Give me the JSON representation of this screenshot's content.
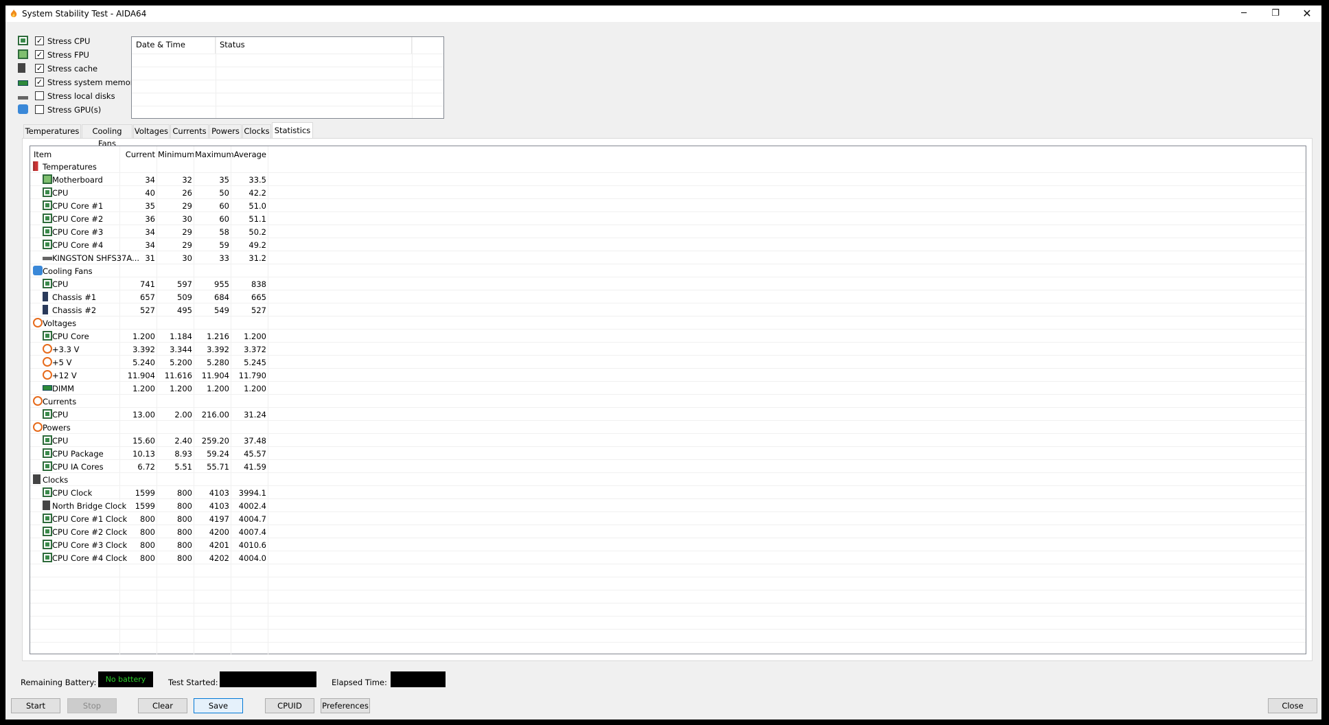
{
  "window": {
    "title": "System Stability Test - AIDA64"
  },
  "stress_options": [
    {
      "label": "Stress CPU",
      "checked": "✓",
      "icon": "cpu-icon"
    },
    {
      "label": "Stress FPU",
      "checked": "✓",
      "icon": "fpu-icon"
    },
    {
      "label": "Stress cache",
      "checked": "✓",
      "icon": "cache-icon"
    },
    {
      "label": "Stress system memory",
      "checked": "✓",
      "icon": "memory-icon"
    },
    {
      "label": "Stress local disks",
      "checked": "",
      "icon": "disk-icon"
    },
    {
      "label": "Stress GPU(s)",
      "checked": "",
      "icon": "gpu-icon"
    }
  ],
  "log": {
    "col_datetime": "Date & Time",
    "col_status": "Status"
  },
  "tabs": [
    "Temperatures",
    "Cooling Fans",
    "Voltages",
    "Currents",
    "Powers",
    "Clocks",
    "Statistics"
  ],
  "active_tab": "Statistics",
  "table": {
    "headers": {
      "item": "Item",
      "current": "Current",
      "minimum": "Minimum",
      "maximum": "Maximum",
      "average": "Average"
    },
    "rows": [
      {
        "name": "Temperatures",
        "group": true,
        "icon": "therm",
        "cur": "",
        "min": "",
        "max": "",
        "avg": ""
      },
      {
        "name": "Motherboard",
        "icon": "board",
        "cur": "34",
        "min": "32",
        "max": "35",
        "avg": "33.5"
      },
      {
        "name": "CPU",
        "icon": "chip",
        "cur": "40",
        "min": "26",
        "max": "50",
        "avg": "42.2"
      },
      {
        "name": "CPU Core #1",
        "icon": "chip",
        "cur": "35",
        "min": "29",
        "max": "60",
        "avg": "51.0"
      },
      {
        "name": "CPU Core #2",
        "icon": "chip",
        "cur": "36",
        "min": "30",
        "max": "60",
        "avg": "51.1"
      },
      {
        "name": "CPU Core #3",
        "icon": "chip",
        "cur": "34",
        "min": "29",
        "max": "58",
        "avg": "50.2"
      },
      {
        "name": "CPU Core #4",
        "icon": "chip",
        "cur": "34",
        "min": "29",
        "max": "59",
        "avg": "49.2"
      },
      {
        "name": "KINGSTON SHFS37A...",
        "icon": "disk",
        "cur": "31",
        "min": "30",
        "max": "33",
        "avg": "31.2"
      },
      {
        "name": "Cooling Fans",
        "group": true,
        "icon": "fan",
        "cur": "",
        "min": "",
        "max": "",
        "avg": ""
      },
      {
        "name": "CPU",
        "icon": "chip",
        "cur": "741",
        "min": "597",
        "max": "955",
        "avg": "838"
      },
      {
        "name": "Chassis #1",
        "icon": "case",
        "cur": "657",
        "min": "509",
        "max": "684",
        "avg": "665"
      },
      {
        "name": "Chassis #2",
        "icon": "case",
        "cur": "527",
        "min": "495",
        "max": "549",
        "avg": "527"
      },
      {
        "name": "Voltages",
        "group": true,
        "icon": "volt",
        "cur": "",
        "min": "",
        "max": "",
        "avg": ""
      },
      {
        "name": "CPU Core",
        "icon": "chip",
        "cur": "1.200",
        "min": "1.184",
        "max": "1.216",
        "avg": "1.200"
      },
      {
        "name": "+3.3 V",
        "icon": "volt",
        "cur": "3.392",
        "min": "3.344",
        "max": "3.392",
        "avg": "3.372"
      },
      {
        "name": "+5 V",
        "icon": "volt",
        "cur": "5.240",
        "min": "5.200",
        "max": "5.280",
        "avg": "5.245"
      },
      {
        "name": "+12 V",
        "icon": "volt",
        "cur": "11.904",
        "min": "11.616",
        "max": "11.904",
        "avg": "11.790"
      },
      {
        "name": "DIMM",
        "icon": "dimm",
        "cur": "1.200",
        "min": "1.200",
        "max": "1.200",
        "avg": "1.200"
      },
      {
        "name": "Currents",
        "group": true,
        "icon": "volt",
        "cur": "",
        "min": "",
        "max": "",
        "avg": ""
      },
      {
        "name": "CPU",
        "icon": "chip",
        "cur": "13.00",
        "min": "2.00",
        "max": "216.00",
        "avg": "31.24"
      },
      {
        "name": "Powers",
        "group": true,
        "icon": "volt",
        "cur": "",
        "min": "",
        "max": "",
        "avg": ""
      },
      {
        "name": "CPU",
        "icon": "chip",
        "cur": "15.60",
        "min": "2.40",
        "max": "259.20",
        "avg": "37.48"
      },
      {
        "name": "CPU Package",
        "icon": "chip",
        "cur": "10.13",
        "min": "8.93",
        "max": "59.24",
        "avg": "45.57"
      },
      {
        "name": "CPU IA Cores",
        "icon": "chip",
        "cur": "6.72",
        "min": "5.51",
        "max": "55.71",
        "avg": "41.59"
      },
      {
        "name": "Clocks",
        "group": true,
        "icon": "clock",
        "cur": "",
        "min": "",
        "max": "",
        "avg": ""
      },
      {
        "name": "CPU Clock",
        "icon": "chip",
        "cur": "1599",
        "min": "800",
        "max": "4103",
        "avg": "3994.1"
      },
      {
        "name": "North Bridge Clock",
        "icon": "clock",
        "cur": "1599",
        "min": "800",
        "max": "4103",
        "avg": "4002.4"
      },
      {
        "name": "CPU Core #1 Clock",
        "icon": "chip",
        "cur": "800",
        "min": "800",
        "max": "4197",
        "avg": "4004.7"
      },
      {
        "name": "CPU Core #2 Clock",
        "icon": "chip",
        "cur": "800",
        "min": "800",
        "max": "4200",
        "avg": "4007.4"
      },
      {
        "name": "CPU Core #3 Clock",
        "icon": "chip",
        "cur": "800",
        "min": "800",
        "max": "4201",
        "avg": "4010.6"
      },
      {
        "name": "CPU Core #4 Clock",
        "icon": "chip",
        "cur": "800",
        "min": "800",
        "max": "4202",
        "avg": "4004.0"
      }
    ]
  },
  "footer": {
    "battery_label": "Remaining Battery:",
    "battery_value": "No battery",
    "test_started_label": "Test Started:",
    "test_started_value": "",
    "elapsed_label": "Elapsed Time:",
    "elapsed_value": ""
  },
  "buttons": {
    "start": "Start",
    "stop": "Stop",
    "clear": "Clear",
    "save": "Save",
    "cpuid": "CPUID",
    "preferences": "Preferences",
    "close": "Close"
  },
  "colors": {
    "battery_text": "#2bd12b",
    "selection_border": "#0078d7"
  }
}
